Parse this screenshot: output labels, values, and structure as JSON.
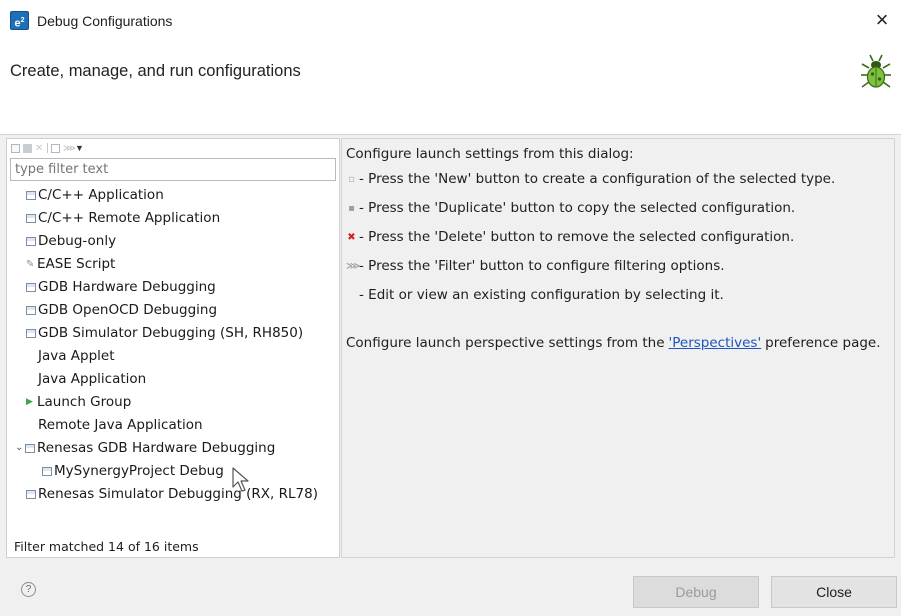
{
  "window": {
    "title": "Debug Configurations",
    "close_glyph": "×",
    "app_icon_text": "e",
    "app_icon_sup": "2"
  },
  "header": {
    "title": "Create, manage, and run configurations",
    "icon": "bug-icon"
  },
  "toolbar": {
    "icons": [
      "new-config-icon",
      "duplicate-icon",
      "delete-icon",
      "collapse-all-icon",
      "filter-icon",
      "view-menu-icon"
    ]
  },
  "filter": {
    "placeholder": "type filter text",
    "value": ""
  },
  "tree": {
    "items": [
      {
        "label": "C/C++ Application",
        "icon": "config-type-icon"
      },
      {
        "label": "C/C++ Remote Application",
        "icon": "config-type-icon"
      },
      {
        "label": "Debug-only",
        "icon": "config-type-icon"
      },
      {
        "label": "EASE Script",
        "icon": "script-icon"
      },
      {
        "label": "GDB Hardware Debugging",
        "icon": "config-type-icon"
      },
      {
        "label": "GDB OpenOCD Debugging",
        "icon": "config-type-icon"
      },
      {
        "label": "GDB Simulator Debugging (SH, RH850)",
        "icon": "config-type-icon"
      },
      {
        "label": "Java Applet",
        "icon": ""
      },
      {
        "label": "Java Application",
        "icon": ""
      },
      {
        "label": "Launch Group",
        "icon": "launch-group-icon"
      },
      {
        "label": "Remote Java Application",
        "icon": ""
      },
      {
        "label": "Renesas GDB Hardware Debugging",
        "icon": "config-type-icon",
        "expanded": true
      },
      {
        "label": "MySynergyProject Debug",
        "icon": "config-icon"
      },
      {
        "label": "Renesas Simulator Debugging (RX, RL78)",
        "icon": "config-type-icon"
      }
    ],
    "status": "Filter matched 14 of 16 items"
  },
  "info": {
    "intro": "Configure launch settings from this dialog:",
    "lines": [
      {
        "icon": "new-icon",
        "text": "- Press the 'New' button to create a configuration of the selected type."
      },
      {
        "icon": "duplicate-icon",
        "text": "- Press the 'Duplicate' button to copy the selected configuration."
      },
      {
        "icon": "delete-icon",
        "text": "- Press the 'Delete' button to remove the selected configuration."
      },
      {
        "icon": "filter-icon",
        "text": "- Press the 'Filter' button to configure filtering options."
      },
      {
        "icon": "",
        "text": "- Edit or view an existing configuration by selecting it."
      }
    ],
    "perspective_prefix": "Configure launch perspective settings from the",
    "perspective_link": "'Perspectives'",
    "perspective_suffix": "preference page."
  },
  "buttons": {
    "help": "?",
    "debug": "Debug",
    "debug_enabled": false,
    "close": "Close"
  },
  "colors": {
    "accent_link": "#1a55c0",
    "delete_red": "#d92020",
    "launch_green": "#3fa34d",
    "app_icon_blue": "#1d6fb8"
  }
}
